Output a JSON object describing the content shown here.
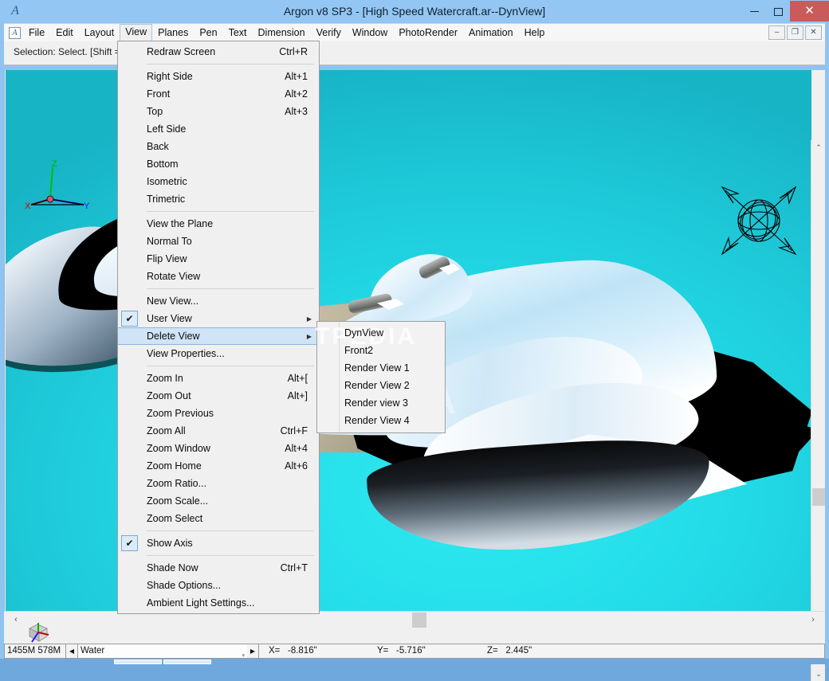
{
  "window": {
    "title": "Argon v8 SP3 - [High Speed Watercraft.ar--DynView]",
    "logo_glyph": "A",
    "minimize_label": "",
    "maximize_label": "",
    "close_label": "✕"
  },
  "menubar": {
    "doc_icon_glyph": "A",
    "items": [
      {
        "label": "File",
        "active": false
      },
      {
        "label": "Edit",
        "active": false
      },
      {
        "label": "Layout",
        "active": false
      },
      {
        "label": "View",
        "active": true
      },
      {
        "label": "Planes",
        "active": false
      },
      {
        "label": "Pen",
        "active": false
      },
      {
        "label": "Text",
        "active": false
      },
      {
        "label": "Dimension",
        "active": false
      },
      {
        "label": "Verify",
        "active": false
      },
      {
        "label": "Window",
        "active": false
      },
      {
        "label": "PhotoRender",
        "active": false
      },
      {
        "label": "Animation",
        "active": false
      },
      {
        "label": "Help",
        "active": false
      }
    ],
    "mdi_buttons": [
      {
        "label": "–",
        "name": "mdi-minimize-button"
      },
      {
        "label": "❐",
        "name": "mdi-restore-button"
      },
      {
        "label": "✕",
        "name": "mdi-close-button"
      }
    ]
  },
  "info_bar": {
    "selection_text": "Selection: Select. [Shift = Ex"
  },
  "view_menu": {
    "rows": [
      {
        "type": "item",
        "label": "Redraw Screen",
        "shortcut": "Ctrl+R"
      },
      {
        "type": "sep"
      },
      {
        "type": "item",
        "label": "Right Side",
        "shortcut": "Alt+1"
      },
      {
        "type": "item",
        "label": "Front",
        "shortcut": "Alt+2"
      },
      {
        "type": "item",
        "label": "Top",
        "shortcut": "Alt+3"
      },
      {
        "type": "item",
        "label": "Left Side",
        "shortcut": ""
      },
      {
        "type": "item",
        "label": "Back",
        "shortcut": ""
      },
      {
        "type": "item",
        "label": "Bottom",
        "shortcut": ""
      },
      {
        "type": "item",
        "label": "Isometric",
        "shortcut": ""
      },
      {
        "type": "item",
        "label": "Trimetric",
        "shortcut": ""
      },
      {
        "type": "sep"
      },
      {
        "type": "item",
        "label": "View the Plane",
        "shortcut": ""
      },
      {
        "type": "item",
        "label": "Normal To",
        "shortcut": ""
      },
      {
        "type": "item",
        "label": "Flip View",
        "shortcut": ""
      },
      {
        "type": "item",
        "label": "Rotate View",
        "shortcut": ""
      },
      {
        "type": "sep"
      },
      {
        "type": "item",
        "label": "New View...",
        "shortcut": ""
      },
      {
        "type": "item",
        "label": "User View",
        "shortcut": "",
        "checked": true,
        "submenu": true
      },
      {
        "type": "item",
        "label": "Delete View",
        "shortcut": "",
        "submenu": true,
        "highlighted": true
      },
      {
        "type": "item",
        "label": "View Properties...",
        "shortcut": ""
      },
      {
        "type": "sep"
      },
      {
        "type": "item",
        "label": "Zoom In",
        "shortcut": "Alt+["
      },
      {
        "type": "item",
        "label": "Zoom Out",
        "shortcut": "Alt+]"
      },
      {
        "type": "item",
        "label": "Zoom Previous",
        "shortcut": ""
      },
      {
        "type": "item",
        "label": "Zoom All",
        "shortcut": "Ctrl+F"
      },
      {
        "type": "item",
        "label": "Zoom Window",
        "shortcut": "Alt+4"
      },
      {
        "type": "item",
        "label": "Zoom Home",
        "shortcut": "Alt+6"
      },
      {
        "type": "item",
        "label": "Zoom Ratio...",
        "shortcut": ""
      },
      {
        "type": "item",
        "label": "Zoom Scale...",
        "shortcut": ""
      },
      {
        "type": "item",
        "label": "Zoom Select",
        "shortcut": ""
      },
      {
        "type": "sep"
      },
      {
        "type": "item",
        "label": "Show Axis",
        "shortcut": "",
        "checked": true
      },
      {
        "type": "sep"
      },
      {
        "type": "item",
        "label": "Shade Now",
        "shortcut": "Ctrl+T"
      },
      {
        "type": "item",
        "label": "Shade Options...",
        "shortcut": ""
      },
      {
        "type": "item",
        "label": "Ambient Light Settings...",
        "shortcut": ""
      }
    ],
    "check_glyph": "✔",
    "submenu_arrow_glyph": "▶"
  },
  "view_submenu": {
    "items": [
      {
        "label": "DynView"
      },
      {
        "label": "Front2"
      },
      {
        "label": "Render View 1"
      },
      {
        "label": "Render View 2"
      },
      {
        "label": "Render view 3"
      },
      {
        "label": "Render View 4"
      }
    ]
  },
  "viewport": {
    "axis_labels": {
      "x": "X",
      "y": "Y",
      "z": "Z"
    },
    "inline_label": "y",
    "watermark": "SOFTPEDIA",
    "submenu_watermark": "TPEDIA",
    "background_color": "#22dce8"
  },
  "scrollbars": {
    "up_arrow": "⌃",
    "down_arrow": "⌄",
    "left_arrow": "‹",
    "right_arrow": "›"
  },
  "status_bar": {
    "memory": "1455M  578M",
    "prev_button": "◀",
    "next_button": "▶",
    "layer_value": "Water",
    "combo_arrow": "▾",
    "coord_x_label": "X=",
    "coord_x_value": "-8.816\"",
    "coord_y_label": "Y=",
    "coord_y_value": "-5.716\"",
    "coord_z_label": "Z=",
    "coord_z_value": "2.445\""
  }
}
